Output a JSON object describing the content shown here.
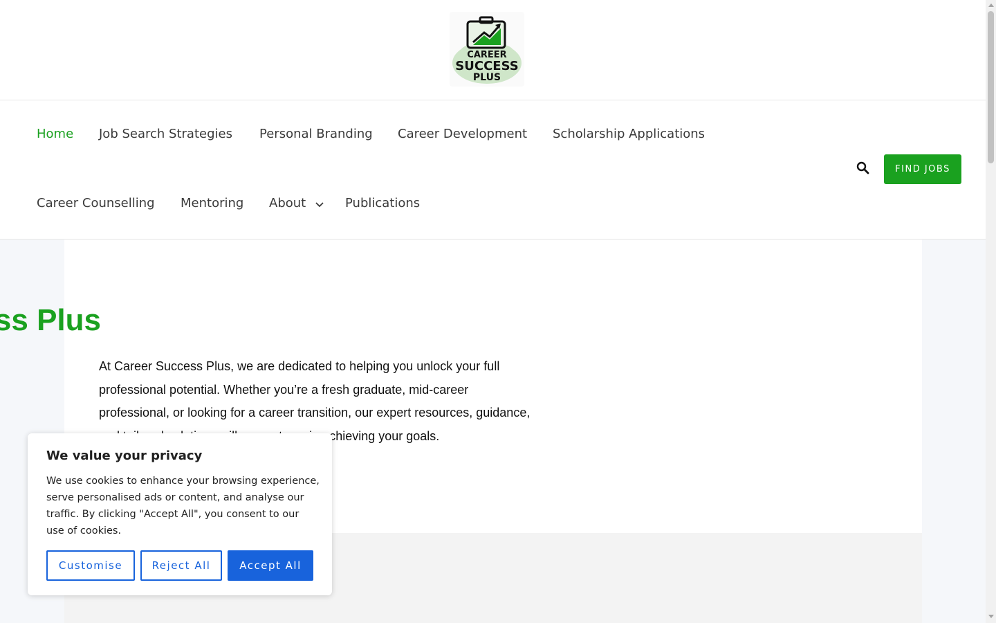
{
  "brand": {
    "logo_line1": "CAREER",
    "logo_line2": "SUCCESS",
    "logo_line3": "PLUS",
    "accent": "#1aa11f"
  },
  "nav": {
    "items": [
      {
        "label": "Home",
        "active": true
      },
      {
        "label": "Job Search Strategies"
      },
      {
        "label": "Personal Branding"
      },
      {
        "label": "Career Development"
      },
      {
        "label": "Scholarship Applications"
      },
      {
        "label": "Career Counselling"
      },
      {
        "label": "Mentoring"
      },
      {
        "label": "About",
        "has_dropdown": true
      },
      {
        "label": "Publications"
      }
    ],
    "search_icon": "search-icon",
    "cta_label": "FIND JOBS"
  },
  "hero": {
    "title": "Career Success Plus",
    "body": "At Career Success Plus, we are dedicated to helping you unlock your full professional potential. Whether you’re a fresh graduate, mid-career professional, or looking for a career transition, our expert resources, guidance, and tailored solutions will support you in achieving your goals."
  },
  "cookie": {
    "title": "We value your privacy",
    "body": "We use cookies to enhance your browsing experience, serve personalised ads or content, and analyse our traffic. By clicking \"Accept All\", you consent to our use of cookies.",
    "customise_label": "Customise",
    "reject_label": "Reject All",
    "accept_label": "Accept All",
    "button_color": "#1863dc"
  }
}
